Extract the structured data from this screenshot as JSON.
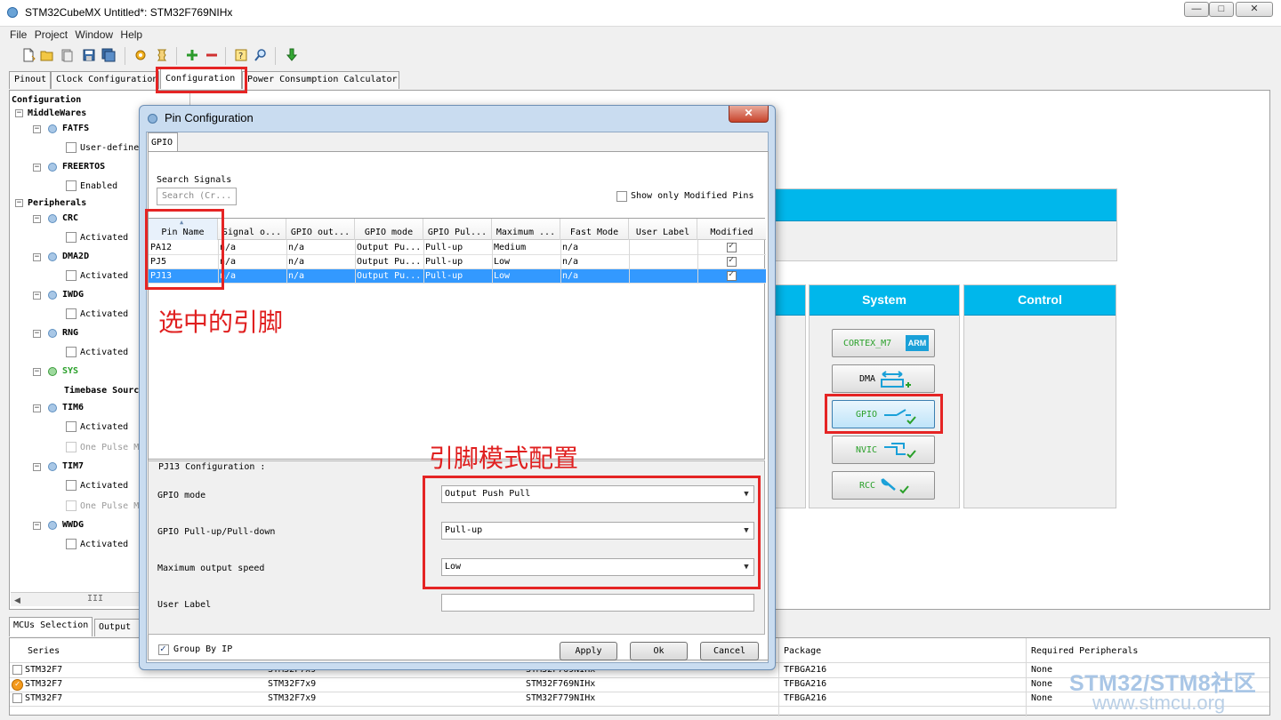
{
  "window": {
    "title": "STM32CubeMX Untitled*: STM32F769NIHx",
    "controls": {
      "minimize": "—",
      "maximize": "□",
      "close": "✕"
    }
  },
  "menu": [
    "File",
    "Project",
    "Window",
    "Help"
  ],
  "main_tabs": [
    "Pinout",
    "Clock Configuration",
    "Configuration",
    "Power Consumption Calculator"
  ],
  "tree": {
    "root": "Configuration",
    "middlewares": {
      "label": "MiddleWares",
      "items": [
        {
          "name": "FATFS",
          "option": "User-defined"
        },
        {
          "name": "FREERTOS",
          "option": "Enabled"
        }
      ]
    },
    "peripherals": {
      "label": "Peripherals",
      "items": [
        {
          "name": "CRC",
          "option": "Activated"
        },
        {
          "name": "DMA2D",
          "option": "Activated"
        },
        {
          "name": "IWDG",
          "option": "Activated"
        },
        {
          "name": "RNG",
          "option": "Activated"
        },
        {
          "name": "SYS",
          "option": "Timebase Source"
        },
        {
          "name": "TIM6",
          "option": "Activated",
          "option2": "One Pulse Mode"
        },
        {
          "name": "TIM7",
          "option": "Activated",
          "option2": "One Pulse Mode"
        },
        {
          "name": "WWDG",
          "option": "Activated"
        }
      ]
    },
    "scroll_thumb": "III"
  },
  "panels": {
    "system": {
      "title": "System",
      "buttons": [
        "CORTEX_M7",
        "DMA",
        "GPIO",
        "NVIC",
        "RCC"
      ],
      "arm_badge": "ARM"
    },
    "control": {
      "title": "Control"
    }
  },
  "dialog": {
    "title": "Pin Configuration",
    "close": "✕",
    "tab": "GPIO",
    "search": {
      "label": "Search Signals",
      "placeholder": "Search (Cr..."
    },
    "show_modified": "Show only Modified Pins",
    "columns": [
      "Pin Name",
      "Signal o...",
      "GPIO out...",
      "GPIO mode",
      "GPIO Pul...",
      "Maximum ...",
      "Fast Mode",
      "User Label",
      "Modified"
    ],
    "rows": [
      {
        "pin": "PA12",
        "signal": "n/a",
        "output": "n/a",
        "mode": "Output Pu...",
        "pull": "Pull-up",
        "speed": "Medium",
        "fast": "n/a",
        "label": "",
        "modified": true
      },
      {
        "pin": "PJ5",
        "signal": "n/a",
        "output": "n/a",
        "mode": "Output Pu...",
        "pull": "Pull-up",
        "speed": "Low",
        "fast": "n/a",
        "label": "",
        "modified": true
      },
      {
        "pin": "PJ13",
        "signal": "n/a",
        "output": "n/a",
        "mode": "Output Pu...",
        "pull": "Pull-up",
        "speed": "Low",
        "fast": "n/a",
        "label": "",
        "modified": true
      }
    ],
    "selected_row": 2,
    "config": {
      "title": "PJ13 Configuration :",
      "gpio_mode": {
        "label": "GPIO mode",
        "value": "Output Push Pull"
      },
      "pull": {
        "label": "GPIO Pull-up/Pull-down",
        "value": "Pull-up"
      },
      "speed": {
        "label": "Maximum output speed",
        "value": "Low"
      },
      "user_label": {
        "label": "User Label",
        "value": ""
      }
    },
    "group_by_ip": "Group By IP",
    "buttons": {
      "apply": "Apply",
      "ok": "Ok",
      "cancel": "Cancel"
    }
  },
  "bottom": {
    "tabs": [
      "MCUs Selection",
      "Output"
    ],
    "columns": [
      "Series",
      "Package",
      "Required Peripherals"
    ],
    "rows": [
      {
        "series": "STM32F7",
        "line": "STM32F7x9",
        "mcu": "STM32F769NIHx",
        "package": "TFBGA216",
        "peripherals": "None"
      },
      {
        "series": "STM32F7",
        "line": "STM32F7x9",
        "mcu": "STM32F769NIHx",
        "package": "TFBGA216",
        "peripherals": "None"
      },
      {
        "series": "STM32F7",
        "line": "STM32F7x9",
        "mcu": "STM32F779NIHx",
        "package": "TFBGA216",
        "peripherals": "None"
      }
    ]
  },
  "annotations": {
    "selected_pin": "选中的引脚",
    "pin_mode_config": "引脚模式配置"
  },
  "watermark": {
    "line1": "STM32/STM8社区",
    "line2": "www.stmcu.org"
  },
  "colors": {
    "accent": "#00b7eb",
    "selection": "#3399ff",
    "annotation_red": "#e52424"
  }
}
